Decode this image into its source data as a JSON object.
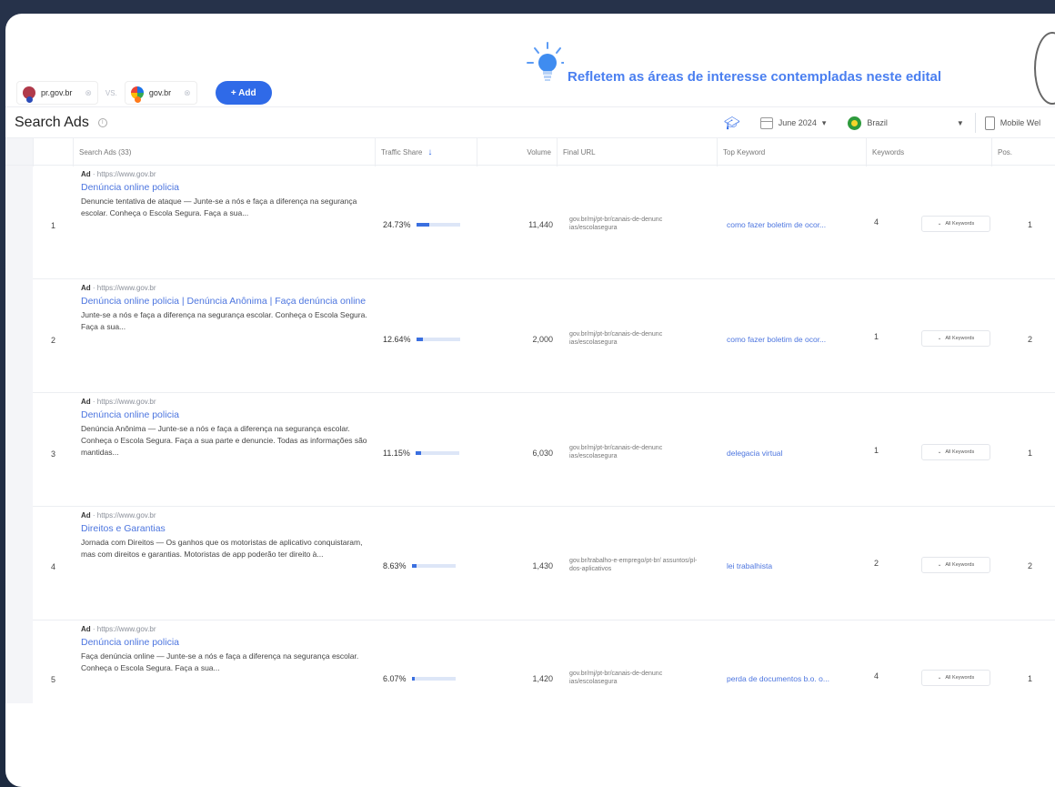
{
  "compare": {
    "domain1": "pr.gov.br",
    "vs": "VS.",
    "domain2": "gov.br",
    "add_label": "+ Add"
  },
  "callout": {
    "text": "Refletem as áreas de interesse contempladas neste edital"
  },
  "section": {
    "title": "Search Ads",
    "date": "June 2024",
    "country": "Brazil",
    "device": "Mobile Wel"
  },
  "table": {
    "headers": {
      "ad": "Search Ads (33)",
      "share": "Traffic Share",
      "volume": "Volume",
      "url": "Final URL",
      "top_keyword": "Top Keyword",
      "keywords": "Keywords",
      "pos": "Pos."
    },
    "all_keywords_label": "All Keywords",
    "rows": [
      {
        "num": "1",
        "ad_label": "Ad",
        "ad_url": " · https://www.gov.br",
        "title": "Denúncia online policia",
        "desc": "Denuncie tentativa de ataque — Junte-se a nós e faça a diferença na segurança escolar. Conheça o Escola Segura. Faça a sua...",
        "share": "24.73%",
        "share_value": 0.2473,
        "volume": "11,440",
        "url": "gov.br/mj/pt-br/canais-de-denunc ias/escolasegura",
        "top_keyword": "como fazer boletim de ocor...",
        "keywords": "4",
        "pos": "1"
      },
      {
        "num": "2",
        "ad_label": "Ad",
        "ad_url": " · https://www.gov.br",
        "title": "Denúncia online policia | Denúncia Anônima | Faça denúncia online",
        "desc": "Junte-se a nós e faça a diferença na segurança escolar. Conheça o Escola Segura. Faça a sua...",
        "share": "12.64%",
        "share_value": 0.1264,
        "volume": "2,000",
        "url": "gov.br/mj/pt-br/canais-de-denunc ias/escolasegura",
        "top_keyword": "como fazer boletim de ocor...",
        "keywords": "1",
        "pos": "2"
      },
      {
        "num": "3",
        "ad_label": "Ad",
        "ad_url": " · https://www.gov.br",
        "title": "Denúncia online policia",
        "desc": "Denúncia Anônima — Junte-se a nós e faça a diferença na segurança escolar. Conheça o Escola Segura. Faça a sua parte e denuncie. Todas as informações são mantidas...",
        "share": "11.15%",
        "share_value": 0.1115,
        "volume": "6,030",
        "url": "gov.br/mj/pt-br/canais-de-denunc ias/escolasegura",
        "top_keyword": "delegacia virtual",
        "keywords": "1",
        "pos": "1"
      },
      {
        "num": "4",
        "ad_label": "Ad",
        "ad_url": " · https://www.gov.br",
        "title": "Direitos e Garantias",
        "desc": "Jornada com Direitos — Os ganhos que os motoristas de aplicativo conquistaram, mas com direitos e garantias. Motoristas de app poderão ter direito à...",
        "share": "8.63%",
        "share_value": 0.0863,
        "volume": "1,430",
        "url": "gov.br/trabalho-e-emprego/pt-br/ assuntos/pl-dos-aplicativos",
        "top_keyword": "lei trabalhista",
        "keywords": "2",
        "pos": "2"
      },
      {
        "num": "5",
        "ad_label": "Ad",
        "ad_url": " · https://www.gov.br",
        "title": "Denúncia online policia",
        "desc": "Faça denúncia online — Junte-se a nós e faça a diferença na segurança escolar. Conheça o Escola Segura. Faça a sua...",
        "share": "6.07%",
        "share_value": 0.0607,
        "volume": "1,420",
        "url": "gov.br/mj/pt-br/canais-de-denunc ias/escolasegura",
        "top_keyword": "perda de documentos b.o. o...",
        "keywords": "4",
        "pos": "1"
      }
    ]
  },
  "colors": {
    "accent": "#2f6ae8",
    "link": "#4c75df",
    "callout": "#4a7ff0",
    "background": "#1d2a40"
  }
}
